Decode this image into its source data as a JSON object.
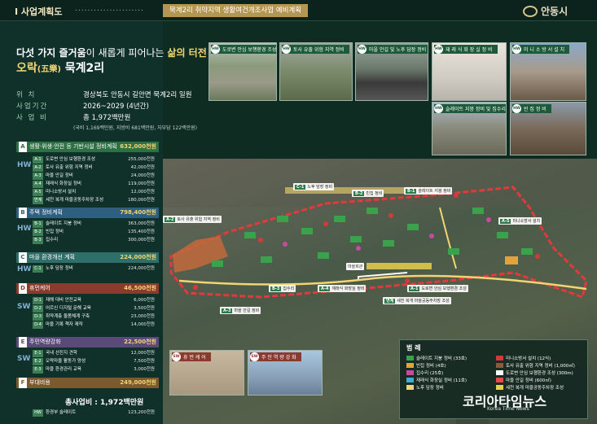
{
  "header": {
    "section": "Ⅰ 사업계획도",
    "dots": "......................",
    "title": "묵계2리 취약지역 생활여건개조사업 예비계획",
    "logo": "안동시"
  },
  "headline": {
    "line1_a": "다섯 가지 즐거움",
    "line1_b": "이 새롭게 피어나는 ",
    "line1_c": "삶의 터전",
    "line2_a": "오락",
    "line2_b": "(五樂)",
    "line2_c": " 묵계2리"
  },
  "info": [
    {
      "key": "위      치",
      "value": "경상북도 안동시 길안면 묵계2리 일원"
    },
    {
      "key": "사업기간",
      "value": "2026~2029 (4년간)"
    },
    {
      "key": "사 업 비",
      "value": "총 1,972백만원"
    }
  ],
  "info_note": "(국비 1,169백만원, 지방비 681백만원, 자부담 122백만원)",
  "categories": [
    {
      "badge": "A",
      "label": "생활·위생·안전 등 기반시설 정비계획",
      "amount": "632,000천원"
    },
    {
      "badge": "B",
      "label": "주택 정비계획",
      "amount": "798,400천원"
    },
    {
      "badge": "C",
      "label": "마을 환경개선 계획",
      "amount": "224,000천원"
    },
    {
      "badge": "D",
      "label": "휴먼케어",
      "amount": "46,500천원"
    },
    {
      "badge": "E",
      "label": "주민역량강화",
      "amount": "22,500천원"
    },
    {
      "badge": "F",
      "label": "부대비용",
      "amount": "249,000천원"
    }
  ],
  "tags": {
    "hw": "HW",
    "sw": "SW"
  },
  "items_a": [
    {
      "code": "A-1",
      "label": "도로변 안심 보행환경 조성",
      "amount": "255,000천원"
    },
    {
      "code": "A-2",
      "label": "토사 유출 위험 지역 정비",
      "amount": "42,000천원"
    },
    {
      "code": "A-3",
      "label": "마을 안길 정비",
      "amount": "24,000천원"
    },
    {
      "code": "A-4",
      "label": "재래식 화장실 정비",
      "amount": "119,000천원"
    },
    {
      "code": "A-5",
      "label": "미니소방서 설치",
      "amount": "12,000천원"
    },
    {
      "code": "연계",
      "label": "세천 복개 마을공동주차장 조성",
      "amount": "180,000천원"
    }
  ],
  "items_b": [
    {
      "code": "B-1",
      "label": "슬레이트 지붕 정비",
      "amount": "363,000천원"
    },
    {
      "code": "B-2",
      "label": "빈집 정비",
      "amount": "135,400천원"
    },
    {
      "code": "B-3",
      "label": "집수리",
      "amount": "300,000천원"
    }
  ],
  "items_c": [
    {
      "code": "C-1",
      "label": "노후 담장 정비",
      "amount": "224,000천원"
    }
  ],
  "items_d": [
    {
      "code": "D-1",
      "label": "재해 대비 안전교육",
      "amount": "6,000천원"
    },
    {
      "code": "D-2",
      "label": "어르신 디지털 문해 교육",
      "amount": "3,500천원"
    },
    {
      "code": "D-3",
      "label": "취약계층 돌봄체계 구축",
      "amount": "23,000천원"
    },
    {
      "code": "D-4",
      "label": "마을 기록 책자 제작",
      "amount": "14,000천원"
    }
  ],
  "items_e": [
    {
      "code": "E-1",
      "label": "국내 선진지 견학",
      "amount": "12,000천원"
    },
    {
      "code": "E-2",
      "label": "오락마을 활동가 양성",
      "amount": "7,500천원"
    },
    {
      "code": "E-3",
      "label": "마을 환경관리 교육",
      "amount": "3,000천원"
    }
  ],
  "items_f": [
    {
      "code": "HW",
      "label": "환경부 슬레이트",
      "amount": "123,200천원"
    }
  ],
  "total": "총사업비 : 1,972백만원",
  "photos": [
    {
      "label": "도로변 안심 보행환경 조성"
    },
    {
      "label": "토사 유출 위험 지역 정비"
    },
    {
      "label": "마을 안길 및 노후 담장 정비"
    },
    {
      "label": "재 래 식  화 장 실  정 비"
    },
    {
      "label": "미 니 소 방 서  설 치"
    },
    {
      "label": "슬레이트 지붕 정비 및 집수리"
    },
    {
      "label": "빈 집  정 비"
    }
  ],
  "sw_photos": [
    {
      "label": "휴 먼 케 어"
    },
    {
      "label": "주 민 역 량 강 화"
    }
  ],
  "map_labels": [
    {
      "code": "C-1",
      "text": "노후 담장 정비"
    },
    {
      "code": "B-2",
      "text": "빈집 정비"
    },
    {
      "code": "B-1",
      "text": "슬레이트 지붕 정비"
    },
    {
      "code": "A-2",
      "text": "토사 유출 위험 지역 정비"
    },
    {
      "code": "A-5",
      "text": "미니소방서 설치"
    },
    {
      "code": "",
      "text": "마을회관"
    },
    {
      "code": "B-3",
      "text": "집수리"
    },
    {
      "code": "A-4",
      "text": "재래식 화장실 정비"
    },
    {
      "code": "A-1",
      "text": "도로변 안심 보행환경 조성"
    },
    {
      "code": "A-3",
      "text": "마을 안길 정비"
    },
    {
      "code": "연계",
      "text": "세천 복개 마을공동주차장 조성"
    }
  ],
  "legend": {
    "title": "범  례",
    "items": [
      {
        "text": "슬레이트 지붕 정비 (33호)",
        "color": "#3aa24a"
      },
      {
        "text": "미니소방서 설치 (12식)",
        "color": "#d23a3a"
      },
      {
        "text": "빈집 정비 (4호)",
        "color": "#e6a23a"
      },
      {
        "text": "토사 유출 위험 지역 정비 (1,000㎡)",
        "color": "#8a5a3a"
      },
      {
        "text": "집수리 (25호)",
        "color": "#c84aa0"
      },
      {
        "text": "도로변 안심 보행환경 조성 (300m)",
        "color": "#ffffff"
      },
      {
        "text": "재래식 화장실 정비 (11호)",
        "color": "#3ab0d0"
      },
      {
        "text": "마을 안길 정비 (600㎡)",
        "color": "#e84a4a"
      },
      {
        "text": "노후 담장 정비",
        "color": "#f2d572"
      },
      {
        "text": "세천 복개 마을공동주차장 조성",
        "color": "#e6d04a"
      }
    ]
  },
  "watermark": {
    "main": "코리아타임뉴스",
    "sub": "Korea Time News"
  }
}
